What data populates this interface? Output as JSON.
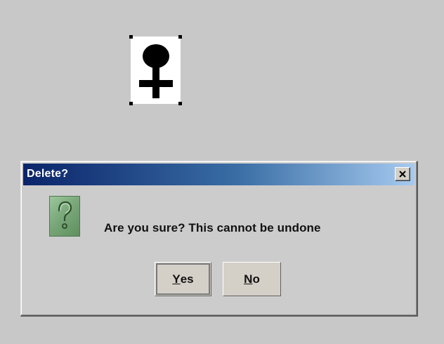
{
  "dialog": {
    "title": "Delete?",
    "message": "Are you sure? This cannot be undone",
    "close_glyph": "close-x-icon",
    "icon": "question-mark-icon",
    "buttons": {
      "yes_mnemonic": "Y",
      "yes_rest": "es",
      "no_mnemonic": "N",
      "no_rest": "o"
    }
  },
  "canvas": {
    "selected_shape_icon": "venus-symbol-icon"
  },
  "colors": {
    "background": "#c8c8c8",
    "title_bar_start": "#0a246a",
    "title_bar_end": "#a6caf0",
    "question_icon": "#7aa87a"
  }
}
